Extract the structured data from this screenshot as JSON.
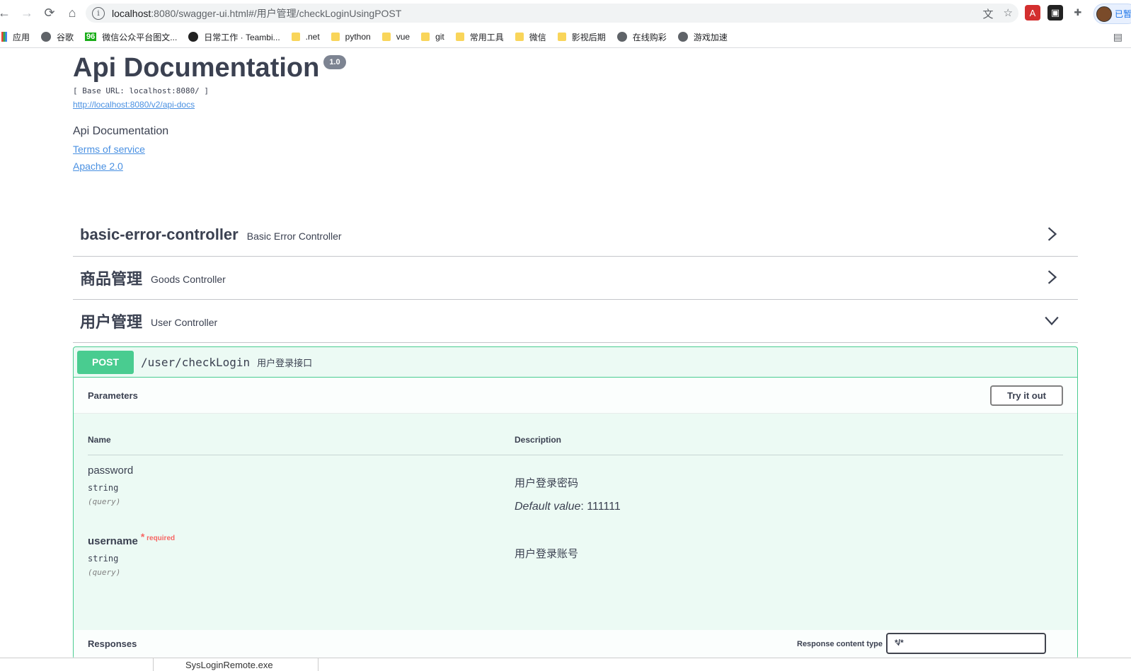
{
  "browser": {
    "url_host": "localhost",
    "url_rest": ":8080/swagger-ui.html#/用户管理/checkLoginUsingPOST",
    "profile_label": "已暂",
    "bookmarks": [
      "应用",
      "谷歌",
      "微信公众平台图文...",
      "日常工作 · Teambi...",
      ".net",
      "python",
      "vue",
      "git",
      "常用工具",
      "微信",
      "影视后期",
      "在线购彩",
      "游戏加速"
    ],
    "bookmark_badge": "96"
  },
  "info": {
    "title": "Api Documentation",
    "version": "1.0",
    "base_url": "[ Base URL: localhost:8080/ ]",
    "docs_link": "http://localhost:8080/v2/api-docs",
    "description": "Api Documentation",
    "terms": "Terms of service",
    "license": "Apache 2.0"
  },
  "tags": [
    {
      "name": "basic-error-controller",
      "description": "Basic Error Controller",
      "expanded": false
    },
    {
      "name": "商品管理",
      "description": "Goods Controller",
      "expanded": false
    },
    {
      "name": "用户管理",
      "description": "User Controller",
      "expanded": true
    }
  ],
  "operation": {
    "method": "POST",
    "path": "/user/checkLogin",
    "summary": "用户登录接口",
    "parameters_label": "Parameters",
    "try_it_out": "Try it out",
    "col_name": "Name",
    "col_description": "Description",
    "params": [
      {
        "name": "password",
        "type": "string",
        "in": "(query)",
        "description": "用户登录密码",
        "default_label": "Default value",
        "default_value": ": 111111",
        "required": false
      },
      {
        "name": "username",
        "type": "string",
        "in": "(query)",
        "description": "用户登录账号",
        "required": true,
        "required_label": "required",
        "required_star": "*"
      }
    ],
    "responses_label": "Responses",
    "response_content_type_label": "Response content type",
    "response_content_type": "*/*"
  },
  "taskbar": {
    "tab_text": "SysLoginRemote.exe"
  },
  "colors": {
    "post": "#49cc90",
    "link": "#4990e2",
    "text": "#3b4151"
  }
}
